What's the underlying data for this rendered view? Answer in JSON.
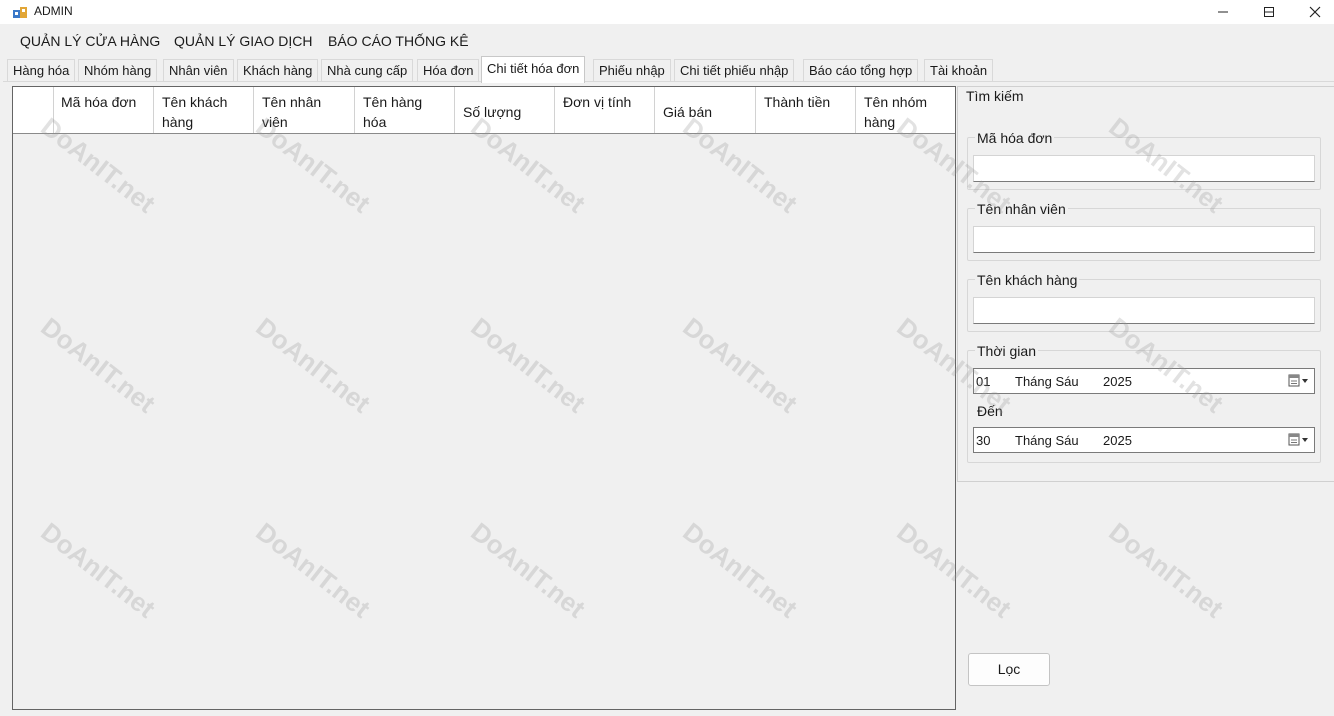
{
  "window": {
    "title": "ADMIN"
  },
  "menu": [
    "QUẢN LÝ CỬA HÀNG",
    "QUẢN LÝ GIAO DỊCH",
    "BÁO CÁO THỐNG KÊ"
  ],
  "tabs": [
    "Hàng hóa",
    "Nhóm hàng",
    "Nhân viên",
    "Khách hàng",
    "Nhà cung cấp",
    "Hóa đơn",
    "Chi tiết hóa đơn",
    "Phiếu nhập",
    "Chi tiết phiếu nhập",
    "Báo cáo tổng hợp",
    "Tài khoản"
  ],
  "active_tab": "Chi tiết hóa đơn",
  "grid": {
    "columns": [
      "Mã hóa đơn",
      "Tên khách hàng",
      "Tên nhân viên",
      "Tên hàng hóa",
      "Số lượng",
      "Đơn vị tính",
      "Giá bán",
      "Thành tiền",
      "Tên nhóm hàng"
    ],
    "rows": []
  },
  "search": {
    "title": "Tìm kiếm",
    "invoice_label": "Mã hóa đơn",
    "invoice_value": "",
    "employee_label": "Tên nhân viên",
    "employee_value": "",
    "customer_label": "Tên khách hàng",
    "customer_value": "",
    "time_label": "Thời gian",
    "from": {
      "day": "01",
      "month": "Tháng Sáu",
      "year": "2025"
    },
    "to_label": "Đến",
    "to": {
      "day": "30",
      "month": "Tháng Sáu",
      "year": "2025"
    },
    "filter_button": "Lọc"
  },
  "watermark": "DoAnIT.net",
  "icons": {
    "app": "app-icon",
    "minimize": "minimize-icon",
    "maximize": "maximize-icon",
    "close": "close-icon",
    "calendar": "calendar-dropdown-icon"
  }
}
